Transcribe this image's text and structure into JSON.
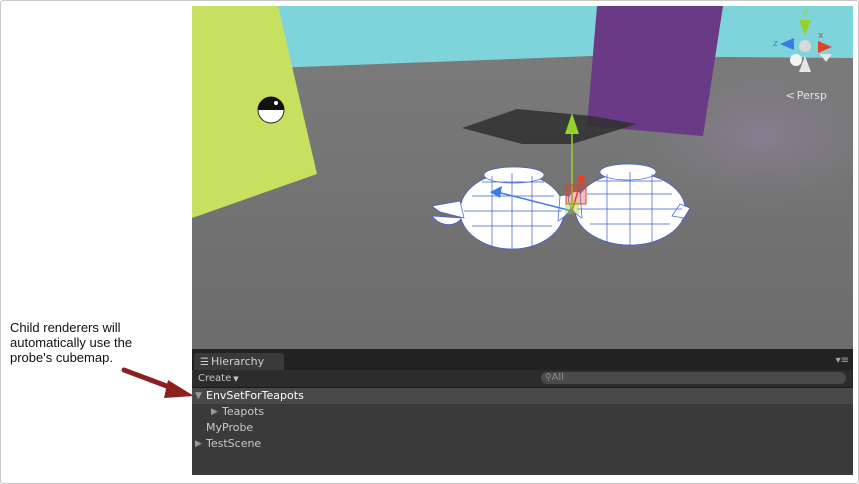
{
  "annotation": {
    "lines": [
      "Child renderers will",
      "automatically use the",
      "probe's cubemap."
    ]
  },
  "scene_view": {
    "camera_label": "Persp",
    "gizmo_axes": [
      "y",
      "x",
      "z"
    ],
    "colors": {
      "sky": "#7fd4dc",
      "ground": "#737373",
      "yellow_wall": "#c8e060",
      "purple_wall": "#6a3a86",
      "wireframe": "#3d5fd8",
      "gizmo_y": "#96d22d",
      "gizmo_x": "#e0432b",
      "gizmo_z": "#3d7be6"
    }
  },
  "hierarchy": {
    "tab_label": "Hierarchy",
    "create_label": "Create",
    "search_placeholder": "All",
    "items": [
      {
        "label": "EnvSetForTeapots",
        "expanded": true,
        "selected": true
      },
      {
        "label": "Teapots",
        "expanded": false,
        "selected": false
      },
      {
        "label": "MyProbe",
        "expanded": null,
        "selected": false
      },
      {
        "label": "TestScene",
        "expanded": false,
        "selected": false
      }
    ]
  }
}
